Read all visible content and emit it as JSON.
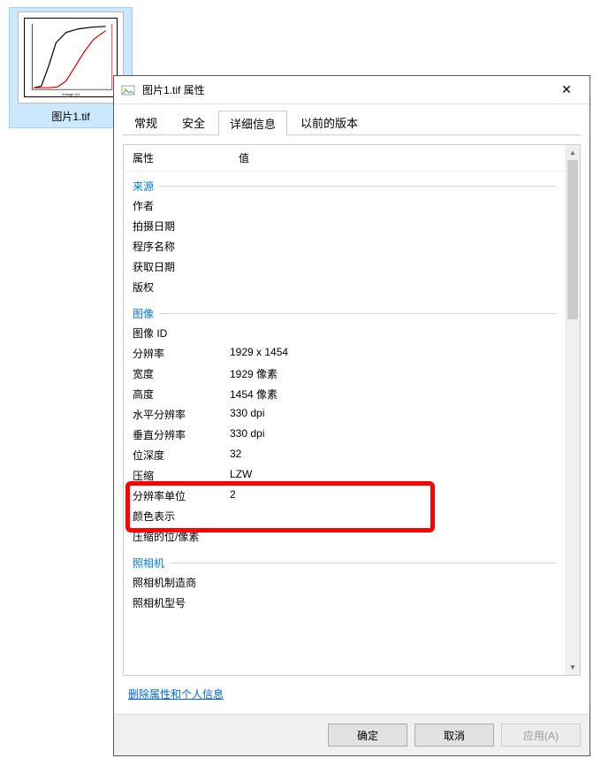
{
  "file": {
    "name": "图片1.tif"
  },
  "dialog": {
    "title": "图片1.tif 属性",
    "close": "✕",
    "tabs": {
      "general": "常规",
      "security": "安全",
      "details": "详细信息",
      "previous": "以前的版本"
    },
    "columns": {
      "property": "属性",
      "value": "值"
    },
    "groups": {
      "origin": {
        "title": "来源",
        "rows": {
          "author": {
            "k": "作者",
            "v": ""
          },
          "date_taken": {
            "k": "拍摄日期",
            "v": ""
          },
          "program_name": {
            "k": "程序名称",
            "v": ""
          },
          "acquired_date": {
            "k": "获取日期",
            "v": ""
          },
          "copyright": {
            "k": "版权",
            "v": ""
          }
        }
      },
      "image": {
        "title": "图像",
        "rows": {
          "image_id": {
            "k": "图像 ID",
            "v": ""
          },
          "dimensions": {
            "k": "分辨率",
            "v": "1929 x 1454"
          },
          "width": {
            "k": "宽度",
            "v": "1929 像素"
          },
          "height": {
            "k": "高度",
            "v": "1454 像素"
          },
          "h_res": {
            "k": "水平分辨率",
            "v": "330 dpi"
          },
          "v_res": {
            "k": "垂直分辨率",
            "v": "330 dpi"
          },
          "bit_depth": {
            "k": "位深度",
            "v": "32"
          },
          "compression": {
            "k": "压缩",
            "v": "LZW"
          },
          "res_unit": {
            "k": "分辨率单位",
            "v": "2"
          },
          "color_rep": {
            "k": "颜色表示",
            "v": ""
          },
          "compressed_bits": {
            "k": "压缩的位/像素",
            "v": ""
          }
        }
      },
      "camera": {
        "title": "照相机",
        "rows": {
          "maker": {
            "k": "照相机制造商",
            "v": ""
          },
          "model": {
            "k": "照相机型号",
            "v": ""
          }
        }
      }
    },
    "link": "删除属性和个人信息",
    "buttons": {
      "ok": "确定",
      "cancel": "取消",
      "apply": "应用(A)"
    }
  },
  "chart_data": null
}
